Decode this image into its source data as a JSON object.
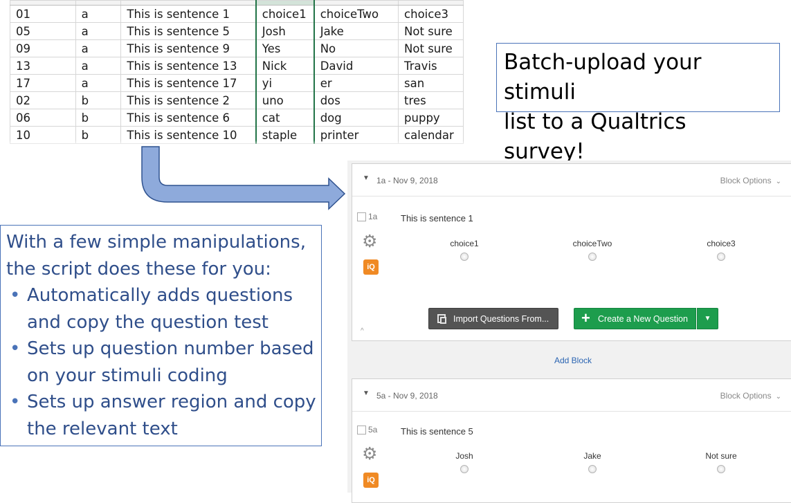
{
  "spreadsheet": {
    "rows": [
      [
        "01",
        "a",
        "This is sentence 1",
        "choice1",
        "choiceTwo",
        "choice3"
      ],
      [
        "05",
        "a",
        "This is sentence 5",
        "Josh",
        "Jake",
        "Not sure"
      ],
      [
        "09",
        "a",
        "This is sentence 9",
        "Yes",
        "No",
        "Not sure"
      ],
      [
        "13",
        "a",
        "This is sentence 13",
        "Nick",
        "David",
        "Travis"
      ],
      [
        "17",
        "a",
        "This is sentence 17",
        "yi",
        "er",
        "san"
      ],
      [
        "02",
        "b",
        "This is sentence 2",
        "uno",
        "dos",
        "tres"
      ],
      [
        "06",
        "b",
        "This is sentence 6",
        "cat",
        "dog",
        "puppy"
      ],
      [
        "10",
        "b",
        "This is sentence 10",
        "staple",
        "printer",
        "calendar"
      ]
    ]
  },
  "callout_top": {
    "line1": "Batch-upload your stimuli",
    "line2": "list to a Qualtrics survey!"
  },
  "callout_left": {
    "intro1": "With a few simple manipulations,",
    "intro2": "the script does these for you:",
    "bullets": [
      {
        "line1": "Automatically adds questions",
        "line2": "and copy the question test"
      },
      {
        "line1": "Sets up question number based",
        "line2": "on your stimuli coding"
      },
      {
        "line1": "Sets up answer region and copy",
        "line2": "the relevant text"
      }
    ]
  },
  "qualtrics": {
    "block1": {
      "title": "1a - Nov 9, 2018",
      "options_label": "Block Options",
      "question": {
        "number": "1a",
        "text": "This is sentence 1",
        "choices": [
          "choice1",
          "choiceTwo",
          "choice3"
        ]
      },
      "import_button": "Import Questions From...",
      "create_button": "Create a New Question"
    },
    "add_block": "Add Block",
    "block2": {
      "title": "5a - Nov 9, 2018",
      "options_label": "Block Options",
      "question": {
        "number": "5a",
        "text": "This is sentence 5",
        "choices": [
          "Josh",
          "Jake",
          "Not sure"
        ]
      }
    },
    "icons": {
      "gear": "gear-icon",
      "iq": "iq-icon",
      "import": "copy-icon",
      "plus": "plus-icon"
    },
    "colors": {
      "create_green": "#1d9d4d",
      "import_gray": "#545454",
      "iq_orange": "#f08a24",
      "link_blue": "#2a64b2"
    }
  },
  "arrow_color": "#8eaadb"
}
